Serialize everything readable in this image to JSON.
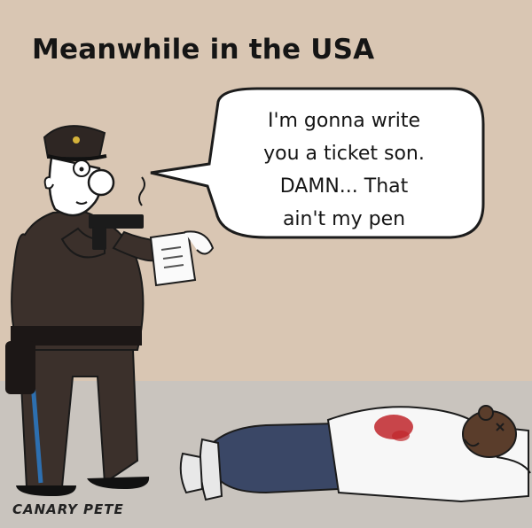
{
  "comic": {
    "headline": "Meanwhile in the USA",
    "speech_bubble": {
      "lines": [
        "I'm gonna write",
        "you a ticket son.",
        "DAMN... That",
        "ain't my pen"
      ]
    },
    "signature": "CANARY PETE"
  },
  "colors": {
    "wall": "#d9c6b3",
    "floor": "#c9c4be",
    "uniform": "#3a302c",
    "skin": "#ffffff",
    "blood": "#c0262b",
    "stripe": "#2d6fb0"
  }
}
